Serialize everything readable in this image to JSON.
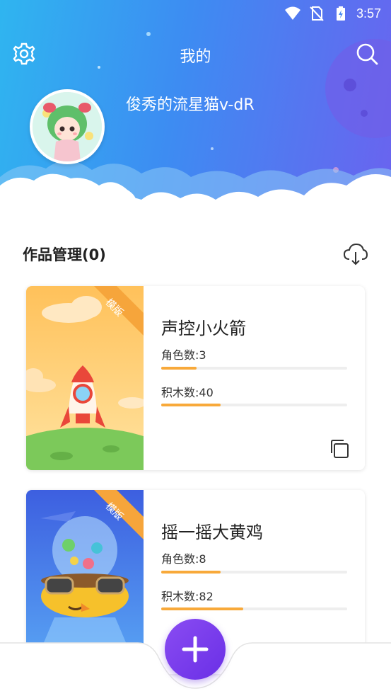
{
  "status_bar": {
    "time": "3:57",
    "icons": [
      "wifi-icon",
      "no-sim-icon",
      "battery-charging-icon"
    ]
  },
  "header": {
    "title": "我的",
    "settings_icon": "gear-icon",
    "search_icon": "search-icon",
    "username": "俊秀的流星猫v-dR",
    "gradient": [
      "#2fb5f0",
      "#6a63ef"
    ]
  },
  "works": {
    "title": "作品管理(0)",
    "download_icon": "cloud-download-icon",
    "items": [
      {
        "badge": "模版",
        "title": "声控小火箭",
        "roles_label": "角色数:3",
        "roles_fraction": 0.19,
        "blocks_label": "积木数:40",
        "blocks_fraction": 0.32,
        "copy_icon": "copy-icon"
      },
      {
        "badge": "模版",
        "title": "摇一摇大黄鸡",
        "roles_label": "角色数:8",
        "roles_fraction": 0.32,
        "blocks_label": "积木数:82",
        "blocks_fraction": 0.44
      }
    ]
  },
  "fab": {
    "icon": "plus-icon"
  },
  "colors": {
    "accent": "#7a3ff0",
    "progress": "#f8a93a",
    "ribbon": "#f6a53b"
  }
}
